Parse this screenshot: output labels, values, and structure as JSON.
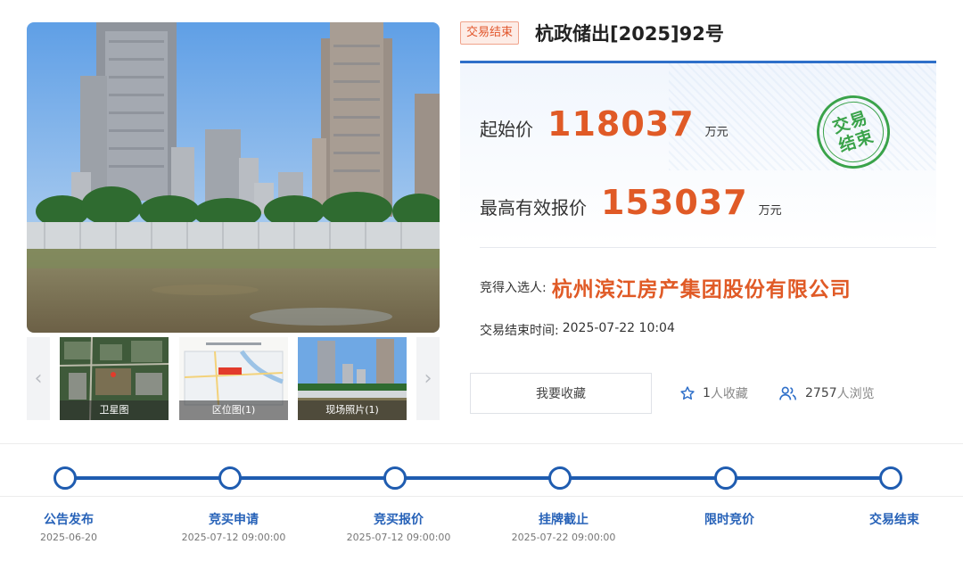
{
  "gallery": {
    "thumbs": [
      {
        "caption": "卫星图"
      },
      {
        "caption": "区位图(1)"
      },
      {
        "caption": "现场照片(1)"
      }
    ]
  },
  "header": {
    "status_tag": "交易结束",
    "title": "杭政储出[2025]92号"
  },
  "prices": {
    "start_label": "起始价",
    "start_value": "118037",
    "start_unit": "万元",
    "high_label": "最高有效报价",
    "high_value": "153037",
    "high_unit": "万元",
    "stamp_text": "交易结束"
  },
  "result": {
    "winner_label": "竞得入选人:",
    "winner_name": "杭州滨江房产集团股份有限公司",
    "end_time_label": "交易结束时间:",
    "end_time_value": "2025-07-22 10:04"
  },
  "actions": {
    "favorite_button": "我要收藏",
    "favorites_count": "1",
    "favorites_suffix": "人收藏",
    "views_count": "2757",
    "views_suffix": "人浏览"
  },
  "timeline": [
    {
      "label": "公告发布",
      "date": "2025-06-20"
    },
    {
      "label": "竞买申请",
      "date": "2025-07-12 09:00:00"
    },
    {
      "label": "竞买报价",
      "date": "2025-07-12 09:00:00"
    },
    {
      "label": "挂牌截止",
      "date": "2025-07-22 09:00:00"
    },
    {
      "label": "限时竞价",
      "date": ""
    },
    {
      "label": "交易结束",
      "date": ""
    }
  ],
  "colors": {
    "accent_orange": "#e05a26",
    "timeline_blue": "#1f5cb0",
    "stamp_green": "#3aa34a"
  }
}
